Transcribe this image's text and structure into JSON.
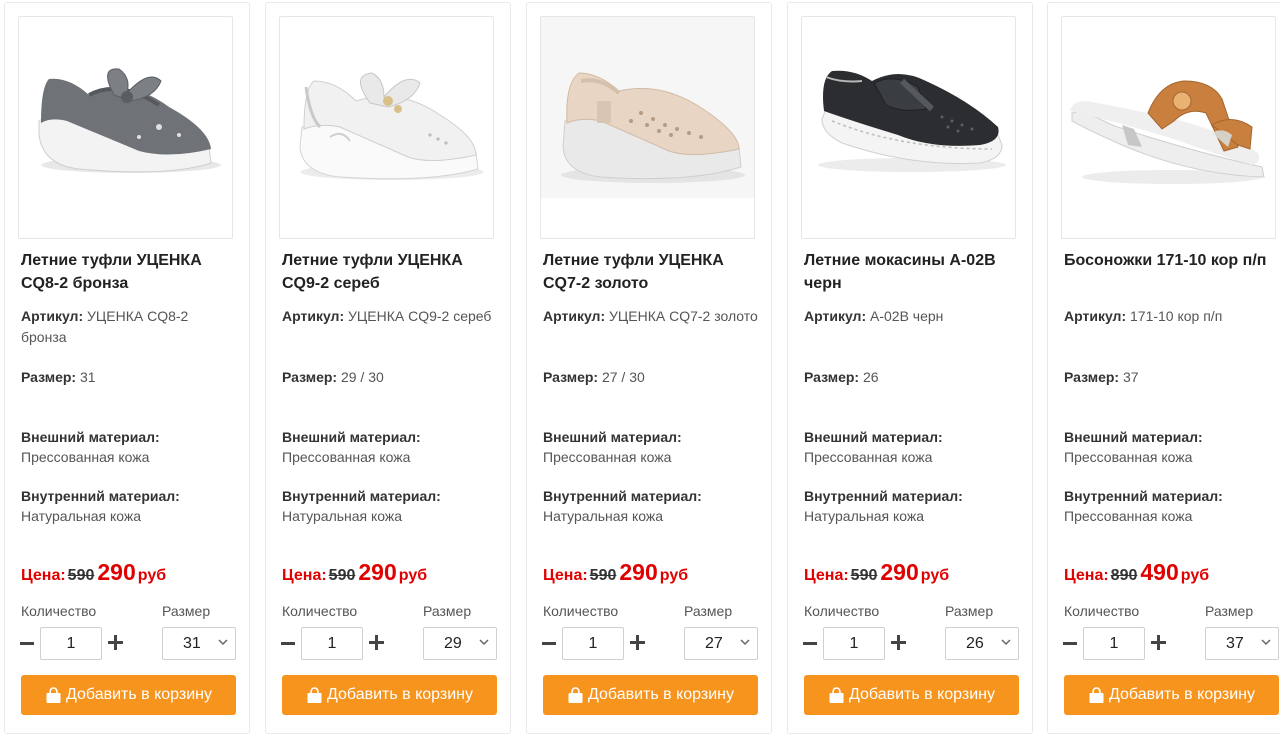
{
  "labels": {
    "sku": "Артикул:",
    "size": "Размер:",
    "outer": "Внешний материал:",
    "inner": "Внутренний материал:",
    "price": "Цена:",
    "currency": "руб",
    "quantity": "Количество",
    "size_select": "Размер",
    "add_to_cart": "Добавить в корзину"
  },
  "colors": {
    "accent_button": "#f7941d",
    "price_red": "#e10000"
  },
  "products": [
    {
      "title": "Летние туфли УЦЕНКА CQ8-2 бронза",
      "sku": "УЦЕНКА CQ8-2 бронза",
      "size": "31",
      "outer_material": "Прессованная кожа",
      "inner_material": "Натуральная кожа",
      "old_price": "590",
      "price": "290",
      "quantity": "1",
      "selected_size": "31",
      "image_icon": "silver-sneaker-with-bow"
    },
    {
      "title": "Летние туфли УЦЕНКА CQ9-2 сереб",
      "sku": "УЦЕНКА CQ9-2 сереб",
      "size": "29 / 30",
      "outer_material": "Прессованная кожа",
      "inner_material": "Натуральная кожа",
      "old_price": "590",
      "price": "290",
      "quantity": "1",
      "selected_size": "29",
      "image_icon": "white-sneaker-with-bow"
    },
    {
      "title": "Летние туфли УЦЕНКА CQ7-2 золото",
      "sku": "УЦЕНКА CQ7-2 золото",
      "size": "27 / 30",
      "outer_material": "Прессованная кожа",
      "inner_material": "Натуральная кожа",
      "old_price": "590",
      "price": "290",
      "quantity": "1",
      "selected_size": "27",
      "image_icon": "beige-slip-on-shoe"
    },
    {
      "title": "Летние мокасины А-02В черн",
      "sku": "А-02В черн",
      "size": "26",
      "outer_material": "Прессованная кожа",
      "inner_material": "Натуральная кожа",
      "old_price": "590",
      "price": "290",
      "quantity": "1",
      "selected_size": "26",
      "image_icon": "black-moccasin"
    },
    {
      "title": "Босоножки 171-10 кор п/п",
      "sku": "171-10 кор п/п",
      "size": "37",
      "outer_material": "Прессованная кожа",
      "inner_material": "Прессованная кожа",
      "old_price": "890",
      "price": "490",
      "quantity": "1",
      "selected_size": "37",
      "image_icon": "tan-sandal"
    }
  ]
}
